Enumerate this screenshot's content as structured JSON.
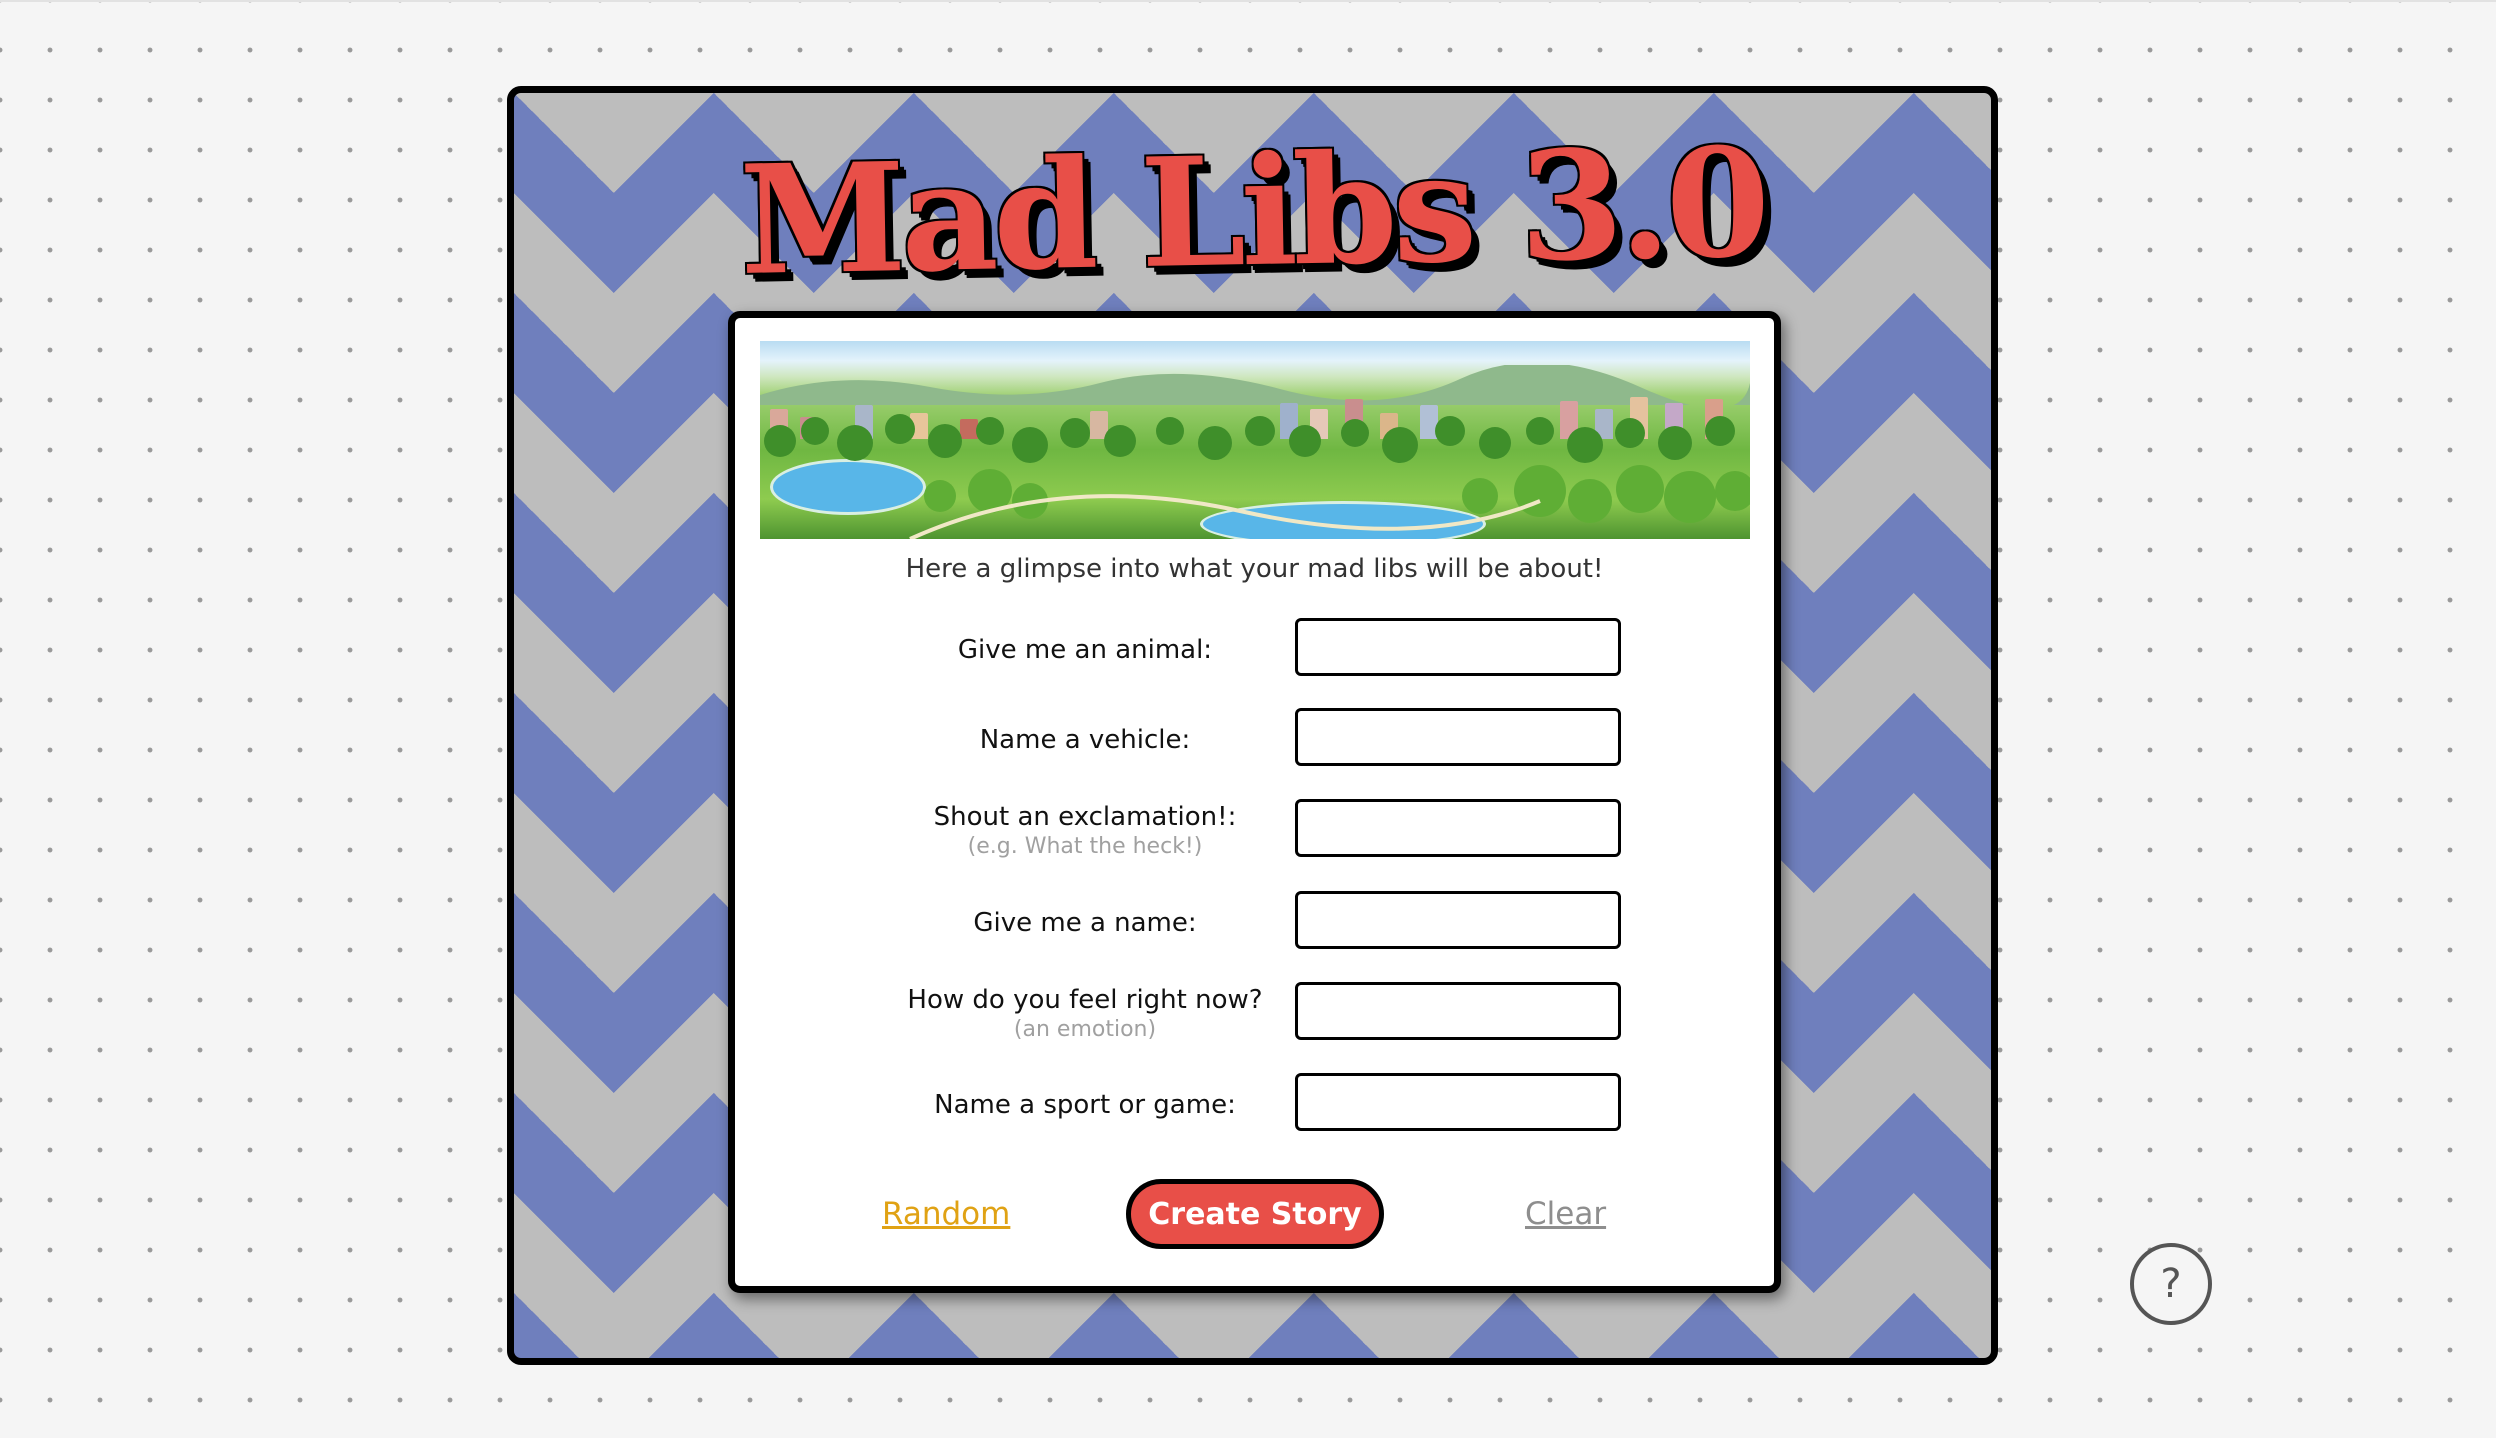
{
  "app": {
    "title": "Mad Libs 3.0"
  },
  "intro": {
    "text": "Here a glimpse into what your mad libs will be about!",
    "image": "city-park-illustration"
  },
  "fields": [
    {
      "label": "Give me an animal:",
      "hint": "",
      "value": ""
    },
    {
      "label": "Name a vehicle:",
      "hint": "",
      "value": ""
    },
    {
      "label": "Shout an exclamation!:",
      "hint": "(e.g. What the heck!)",
      "value": ""
    },
    {
      "label": "Give me a name:",
      "hint": "",
      "value": ""
    },
    {
      "label": "How do you feel right now?",
      "hint": "(an emotion)",
      "value": ""
    },
    {
      "label": "Name a sport or game:",
      "hint": "",
      "value": ""
    }
  ],
  "actions": {
    "random_label": "Random",
    "create_label": "Create Story",
    "clear_label": "Clear"
  },
  "help": {
    "label": "?"
  },
  "colors": {
    "title_red": "#e84f48",
    "chevron_blue": "#6f7fbd",
    "chevron_grey": "#bdbdbd",
    "random_gold": "#e0a214",
    "clear_grey": "#8e8e8e"
  }
}
